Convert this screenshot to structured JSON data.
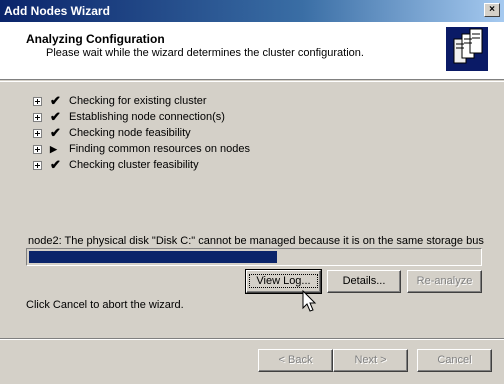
{
  "window": {
    "title": "Add Nodes Wizard",
    "close_glyph": "×"
  },
  "header": {
    "title": "Analyzing Configuration",
    "subtitle": "Please wait while the wizard determines the cluster configuration.",
    "icon": "cluster-servers-icon"
  },
  "tasks": [
    {
      "status": "done",
      "glyph": "✔",
      "label": "Checking for existing cluster"
    },
    {
      "status": "done",
      "glyph": "✔",
      "label": "Establishing node connection(s)"
    },
    {
      "status": "done",
      "glyph": "✔",
      "label": "Checking node feasibility"
    },
    {
      "status": "in-progress",
      "glyph": "▶",
      "label": "Finding common resources on nodes"
    },
    {
      "status": "done",
      "glyph": "✔",
      "label": "Checking cluster feasibility"
    }
  ],
  "status_message": "node2: The physical disk \"Disk C:\" cannot be managed because it is on the same storage bus",
  "progress": {
    "fraction": 0.55,
    "color": "#0a246a"
  },
  "actions": {
    "view_log": "View Log...",
    "details": "Details...",
    "reanalyze": "Re-analyze"
  },
  "cancel_hint": "Click Cancel to abort the wizard.",
  "footer": {
    "back": "< Back",
    "next": "Next >",
    "cancel": "Cancel"
  }
}
